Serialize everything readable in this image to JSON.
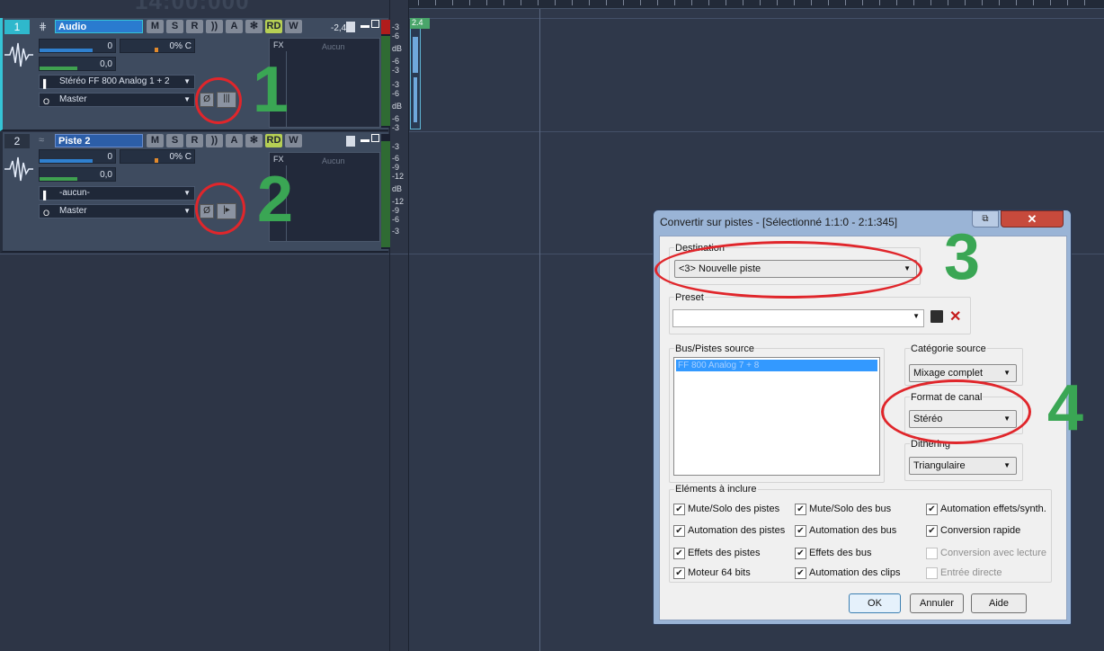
{
  "timecode": "14:00:000",
  "tracks": [
    {
      "number": "1",
      "name": "Audio",
      "volume_readout": "-2,4",
      "buttons": [
        "M",
        "S",
        "R",
        "))",
        "A",
        "✻",
        "RD",
        "W"
      ],
      "vol_value": "0",
      "pan_value": "0% C",
      "trim_value": "0,0",
      "input": "Stéréo FF 800 Analog 1 + 2",
      "output": "Master",
      "fx_label": "FX",
      "fx_value": "Aucun",
      "scale": [
        "-3",
        "-6",
        "dB",
        "-6",
        "-3",
        "-3",
        "-6",
        "dB",
        "-6",
        "-3"
      ]
    },
    {
      "number": "2",
      "name": "Piste 2",
      "buttons": [
        "M",
        "S",
        "R",
        "))",
        "A",
        "✻",
        "RD",
        "W"
      ],
      "vol_value": "0",
      "pan_value": "0% C",
      "trim_value": "0,0",
      "input": "-aucun-",
      "output": "Master",
      "fx_label": "FX",
      "fx_value": "Aucun",
      "scale": [
        "-3",
        "-6",
        "-9",
        "-12",
        "dB",
        "-12",
        "-9",
        "-6",
        "-3"
      ]
    }
  ],
  "clip_label": "2.4",
  "annotations": [
    "1",
    "2",
    "3",
    "4"
  ],
  "dialog": {
    "title": "Convertir sur pistes - [Sélectionné 1:1:0 - 2:1:345]",
    "destination_label": "Destination",
    "destination_value": "<3> Nouvelle piste",
    "preset_label": "Preset",
    "preset_value": "",
    "source_label": "Bus/Pistes source",
    "source_items": [
      "FF 800 Analog 7 + 8"
    ],
    "category_label": "Catégorie source",
    "category_value": "Mixage complet",
    "channel_label": "Format de canal",
    "channel_value": "Stéréo",
    "dithering_label": "Dithering",
    "dithering_value": "Triangulaire",
    "include_label": "Eléments à inclure",
    "checkboxes": [
      {
        "label": "Mute/Solo des pistes",
        "checked": true
      },
      {
        "label": "Automation des pistes",
        "checked": true
      },
      {
        "label": "Effets des pistes",
        "checked": true
      },
      {
        "label": "Moteur 64 bits",
        "checked": true
      },
      {
        "label": "Mute/Solo des bus",
        "checked": true
      },
      {
        "label": "Automation des bus",
        "checked": true
      },
      {
        "label": "Effets des bus",
        "checked": true
      },
      {
        "label": "Automation des clips",
        "checked": true
      },
      {
        "label": "Automation effets/synth.",
        "checked": true
      },
      {
        "label": "Conversion rapide",
        "checked": true
      },
      {
        "label": "Conversion avec lecture",
        "checked": false
      },
      {
        "label": "Entrée directe",
        "checked": false
      }
    ],
    "ok_label": "OK",
    "cancel_label": "Annuler",
    "help_label": "Aide"
  }
}
